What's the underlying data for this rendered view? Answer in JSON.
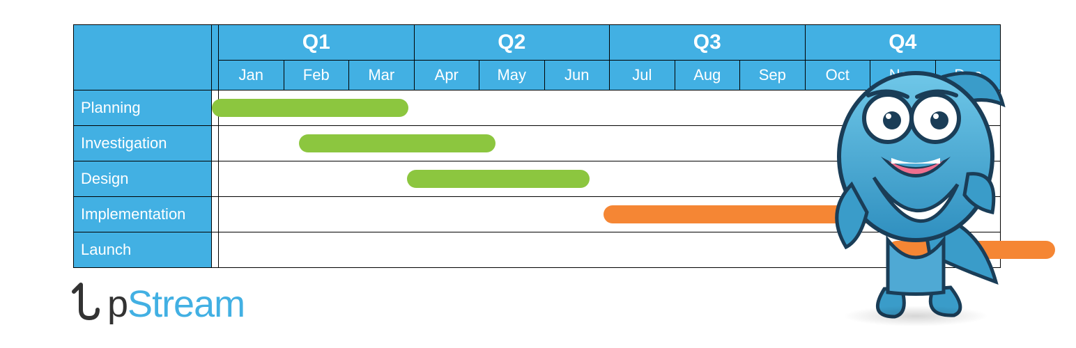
{
  "chart_data": {
    "type": "gantt",
    "quarters": [
      "Q1",
      "Q2",
      "Q3",
      "Q4"
    ],
    "months": [
      "Jan",
      "Feb",
      "Mar",
      "Apr",
      "May",
      "Jun",
      "Jul",
      "Aug",
      "Sep",
      "Oct",
      "Nov",
      "Dec"
    ],
    "tasks": [
      {
        "name": "Planning",
        "start_month": "Jan",
        "end_month": "Mar",
        "color": "green"
      },
      {
        "name": "Investigation",
        "start_month": "Feb",
        "end_month": "Apr",
        "color": "green"
      },
      {
        "name": "Design",
        "start_month": "Apr",
        "end_month": "Jun",
        "color": "green"
      },
      {
        "name": "Implementation",
        "start_month": "Jul",
        "end_month": "Nov",
        "color": "orange"
      },
      {
        "name": "Launch",
        "start_month": "Nov",
        "end_month": "Dec",
        "color": "orange"
      }
    ]
  },
  "colors": {
    "header_blue": "#42b0e3",
    "bar_green": "#8cc63f",
    "bar_orange": "#f58634"
  },
  "logo": {
    "part1": "p",
    "part2": "Stream",
    "full": "UpStream"
  },
  "mascot": {
    "name": "fish-mascot"
  }
}
